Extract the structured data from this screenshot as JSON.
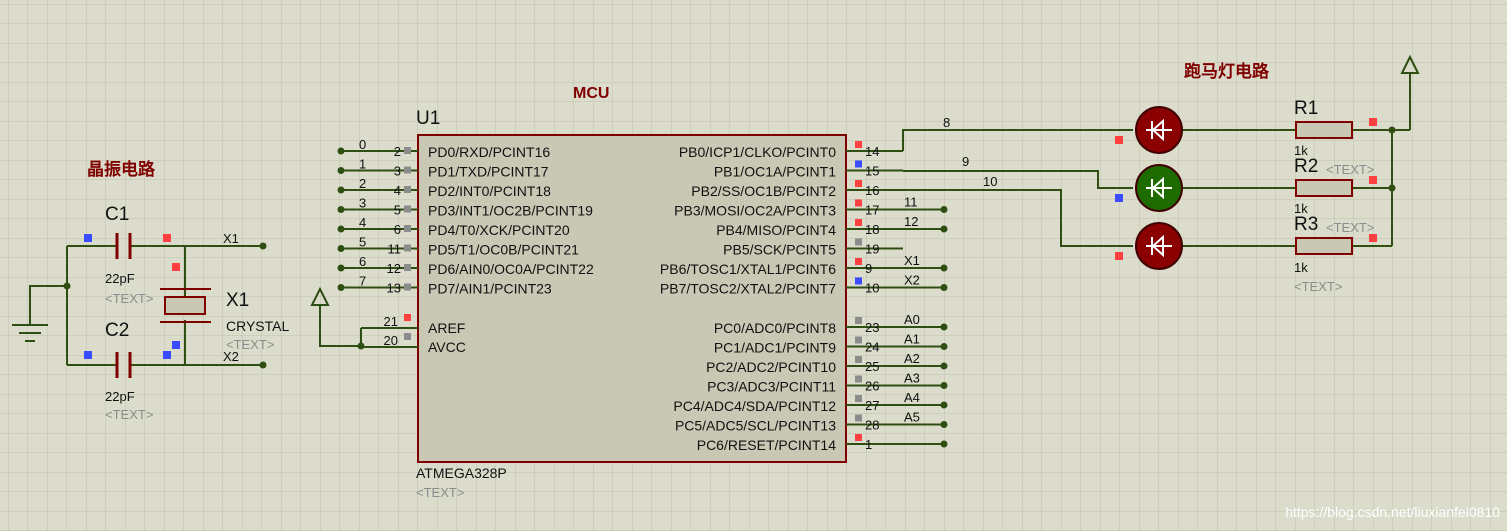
{
  "colors": {
    "background": "#dcdccc",
    "grid": "#bfbfad",
    "wire": "#2e4e12",
    "component": "#800000",
    "chip_fill": "#c8c8b4",
    "pin_red": "#ff4040",
    "pin_blue": "#3a4cff",
    "pin_gray": "#8c8c8c",
    "section_label": "#800000",
    "hidden_text": "#8c8c8c"
  },
  "labels": {
    "mcu": "MCU",
    "crystal_circuit": "晶振电路",
    "led_circuit": "跑马灯电路"
  },
  "chip": {
    "ref": "U1",
    "part": "ATMEGA328P",
    "text_placeholder": "<TEXT>",
    "left_pins": [
      {
        "num": "2",
        "name": "PD0/RXD/PCINT16",
        "net": "0"
      },
      {
        "num": "3",
        "name": "PD1/TXD/PCINT17",
        "net": "1"
      },
      {
        "num": "4",
        "name": "PD2/INT0/PCINT18",
        "net": "2"
      },
      {
        "num": "5",
        "name": "PD3/INT1/OC2B/PCINT19",
        "net": "3"
      },
      {
        "num": "6",
        "name": "PD4/T0/XCK/PCINT20",
        "net": "4"
      },
      {
        "num": "11",
        "name": "PD5/T1/OC0B/PCINT21",
        "net": "5"
      },
      {
        "num": "12",
        "name": "PD6/AIN0/OC0A/PCINT22",
        "net": "6"
      },
      {
        "num": "13",
        "name": "PD7/AIN1/PCINT23",
        "net": "7"
      }
    ],
    "power_pins": [
      {
        "num": "21",
        "name": "AREF"
      },
      {
        "num": "20",
        "name": "AVCC"
      }
    ],
    "right_pins_b": [
      {
        "num": "14",
        "name": "PB0/ICP1/CLKO/PCINT0",
        "net": "8"
      },
      {
        "num": "15",
        "name": "PB1/OC1A/PCINT1",
        "net": "9"
      },
      {
        "num": "16",
        "name": "PB2/SS/OC1B/PCINT2",
        "net": "10"
      },
      {
        "num": "17",
        "name": "PB3/MOSI/OC2A/PCINT3",
        "net": "11"
      },
      {
        "num": "18",
        "name": "PB4/MISO/PCINT4",
        "net": "12"
      },
      {
        "num": "19",
        "name": "PB5/SCK/PCINT5",
        "net": ""
      },
      {
        "num": "9",
        "name": "PB6/TOSC1/XTAL1/PCINT6",
        "net": "X1"
      },
      {
        "num": "10",
        "name": "PB7/TOSC2/XTAL2/PCINT7",
        "net": "X2"
      }
    ],
    "right_pins_c": [
      {
        "num": "23",
        "name": "PC0/ADC0/PCINT8",
        "net": "A0"
      },
      {
        "num": "24",
        "name": "PC1/ADC1/PCINT9",
        "net": "A1"
      },
      {
        "num": "25",
        "name": "PC2/ADC2/PCINT10",
        "net": "A2"
      },
      {
        "num": "26",
        "name": "PC3/ADC3/PCINT11",
        "net": "A3"
      },
      {
        "num": "27",
        "name": "PC4/ADC4/SDA/PCINT12",
        "net": "A4"
      },
      {
        "num": "28",
        "name": "PC5/ADC5/SCL/PCINT13",
        "net": "A5"
      },
      {
        "num": "1",
        "name": "PC6/RESET/PCINT14",
        "net": ""
      }
    ]
  },
  "crystal": {
    "c1": {
      "ref": "C1",
      "value": "22pF",
      "text": "<TEXT>"
    },
    "c2": {
      "ref": "C2",
      "value": "22pF",
      "text": "<TEXT>"
    },
    "x1": {
      "ref": "X1",
      "value": "CRYSTAL",
      "text": "<TEXT>"
    },
    "net_x1": "X1",
    "net_x2": "X2"
  },
  "leds": {
    "r1": {
      "ref": "R1",
      "value": "1k"
    },
    "r2": {
      "ref": "R2",
      "value": "1k",
      "text": "<TEXT>"
    },
    "r3": {
      "ref": "R3",
      "value": "1k",
      "text": "<TEXT>"
    },
    "led_colors": [
      "#8a0000",
      "#1e6b00",
      "#8a0000"
    ]
  },
  "watermark": "https://blog.csdn.net/liuxianfei0810"
}
